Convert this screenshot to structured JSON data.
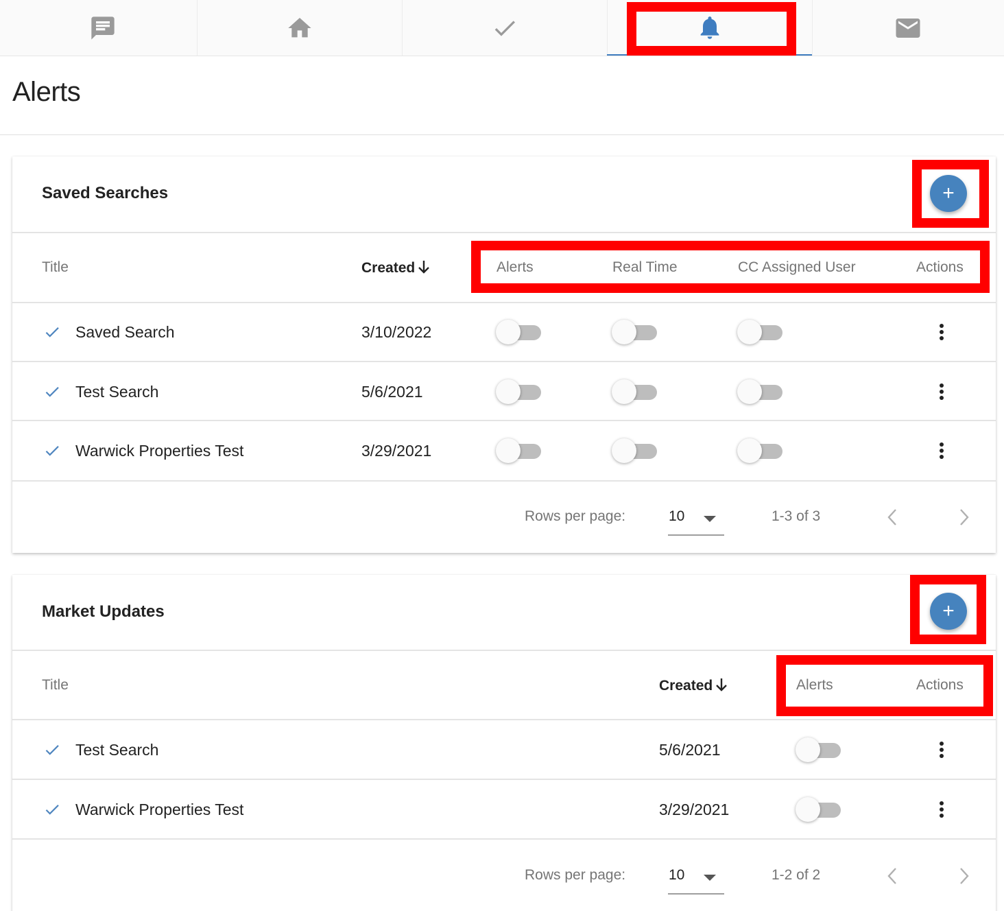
{
  "nav": {
    "tabs": [
      {
        "icon": "message-icon",
        "active": false
      },
      {
        "icon": "home-icon",
        "active": false
      },
      {
        "icon": "check-icon",
        "active": false
      },
      {
        "icon": "bell-icon",
        "active": true
      },
      {
        "icon": "mail-icon",
        "active": false
      }
    ],
    "active_color": "#3f7dc0",
    "inactive_color": "#9a9a9a"
  },
  "page": {
    "title": "Alerts"
  },
  "saved_searches": {
    "title": "Saved Searches",
    "add_label": "+",
    "columns": {
      "title": "Title",
      "created": "Created",
      "alerts": "Alerts",
      "real_time": "Real Time",
      "cc_assigned_user": "CC Assigned User",
      "actions": "Actions"
    },
    "rows": [
      {
        "title": "Saved Search",
        "created": "3/10/2022",
        "alerts": false,
        "real_time": false,
        "cc_assigned_user": false
      },
      {
        "title": "Test Search",
        "created": "5/6/2021",
        "alerts": false,
        "real_time": false,
        "cc_assigned_user": false
      },
      {
        "title": "Warwick Properties Test",
        "created": "3/29/2021",
        "alerts": false,
        "real_time": false,
        "cc_assigned_user": false
      }
    ],
    "pagination": {
      "rows_per_page_label": "Rows per page:",
      "rows_per_page": "10",
      "range": "1-3 of 3"
    }
  },
  "market_updates": {
    "title": "Market Updates",
    "add_label": "+",
    "columns": {
      "title": "Title",
      "created": "Created",
      "alerts": "Alerts",
      "actions": "Actions"
    },
    "rows": [
      {
        "title": "Test Search",
        "created": "5/6/2021",
        "alerts": false
      },
      {
        "title": "Warwick Properties Test",
        "created": "3/29/2021",
        "alerts": false
      }
    ],
    "pagination": {
      "rows_per_page_label": "Rows per page:",
      "rows_per_page": "10",
      "range": "1-2 of 2"
    }
  },
  "colors": {
    "accent": "#4683be",
    "highlight": "#ff0000",
    "check": "#4f86bf",
    "toggle_off_track": "#bdbdbd"
  }
}
